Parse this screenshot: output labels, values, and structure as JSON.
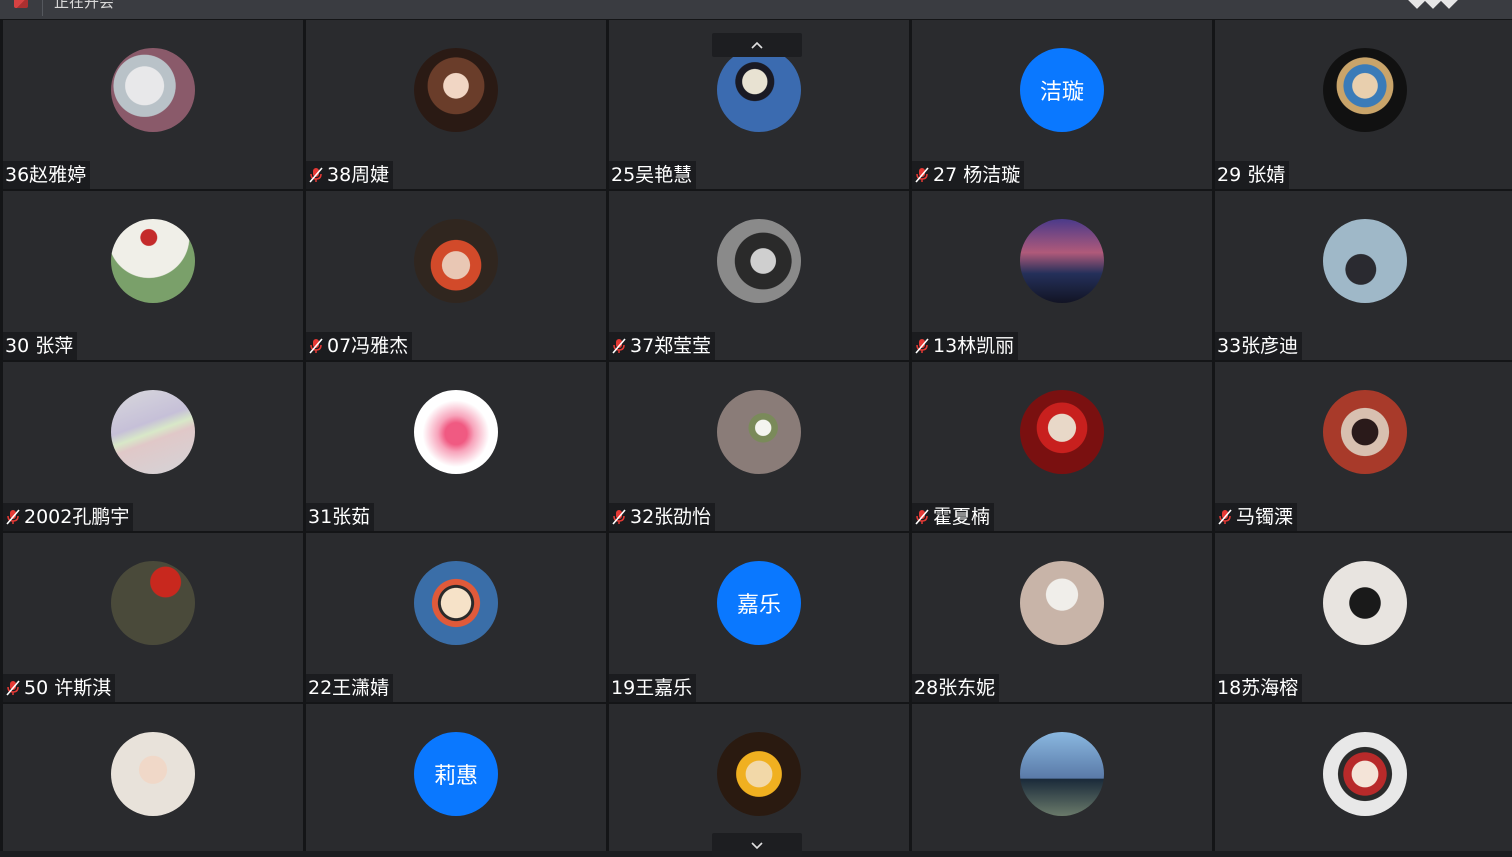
{
  "window": {
    "title": "正在开会"
  },
  "colors": {
    "initials_bg": "#0a78ff",
    "tile_bg": "#2a2b2e",
    "mic_off": "#e53935"
  },
  "participants": [
    {
      "name": "36赵雅婷",
      "muted": false,
      "avatar": "photo-girl-fur-hood"
    },
    {
      "name": "38周婕",
      "muted": true,
      "avatar": "photo-girl-bob-hair"
    },
    {
      "name": "25吴艳慧",
      "muted": false,
      "avatar": "illustration-girl-blue"
    },
    {
      "name": "27 杨洁璇",
      "muted": true,
      "initials": "洁璇"
    },
    {
      "name": "29 张婧",
      "muted": false,
      "avatar": "art-pearl-earring"
    },
    {
      "name": "30 张萍",
      "muted": false,
      "avatar": "photo-stop-sign-person"
    },
    {
      "name": "07冯雅杰",
      "muted": true,
      "avatar": "photo-girl-helmet"
    },
    {
      "name": "37郑莹莹",
      "muted": true,
      "avatar": "photo-profile-bw"
    },
    {
      "name": "13林凯丽",
      "muted": true,
      "avatar": "photo-city-night"
    },
    {
      "name": "33张彦迪",
      "muted": false,
      "avatar": "photo-girl-street-lamp"
    },
    {
      "name": "2002孔鹏宇",
      "muted": true,
      "avatar": "photo-rainbow-blur"
    },
    {
      "name": "31张茹",
      "muted": false,
      "avatar": "pink-heart-glow"
    },
    {
      "name": "32张劭怡",
      "muted": true,
      "avatar": "photo-white-flower"
    },
    {
      "name": "霍夏楠",
      "muted": true,
      "avatar": "art-red-sunglasses"
    },
    {
      "name": "马镯溧",
      "muted": true,
      "avatar": "photo-girl-red-wall"
    },
    {
      "name": "50 许斯淇",
      "muted": true,
      "avatar": "photo-soldiers-flag"
    },
    {
      "name": "22王潇婧",
      "muted": false,
      "avatar": "cartoon-crayon-shin"
    },
    {
      "name": "19王嘉乐",
      "muted": false,
      "initials": "嘉乐"
    },
    {
      "name": "28张东妮",
      "muted": false,
      "avatar": "photo-white-cat-paw"
    },
    {
      "name": "18苏海榕",
      "muted": false,
      "avatar": "photo-girl-phone-mirror"
    },
    {
      "name": "",
      "muted": false,
      "avatar": "photo-baby-glasses"
    },
    {
      "name": "",
      "muted": false,
      "initials": "莉惠"
    },
    {
      "name": "",
      "muted": false,
      "avatar": "anime-zenitsu"
    },
    {
      "name": "",
      "muted": false,
      "avatar": "photo-hand-heart-sky"
    },
    {
      "name": "",
      "muted": false,
      "avatar": "anime-girl-red-cap"
    }
  ]
}
